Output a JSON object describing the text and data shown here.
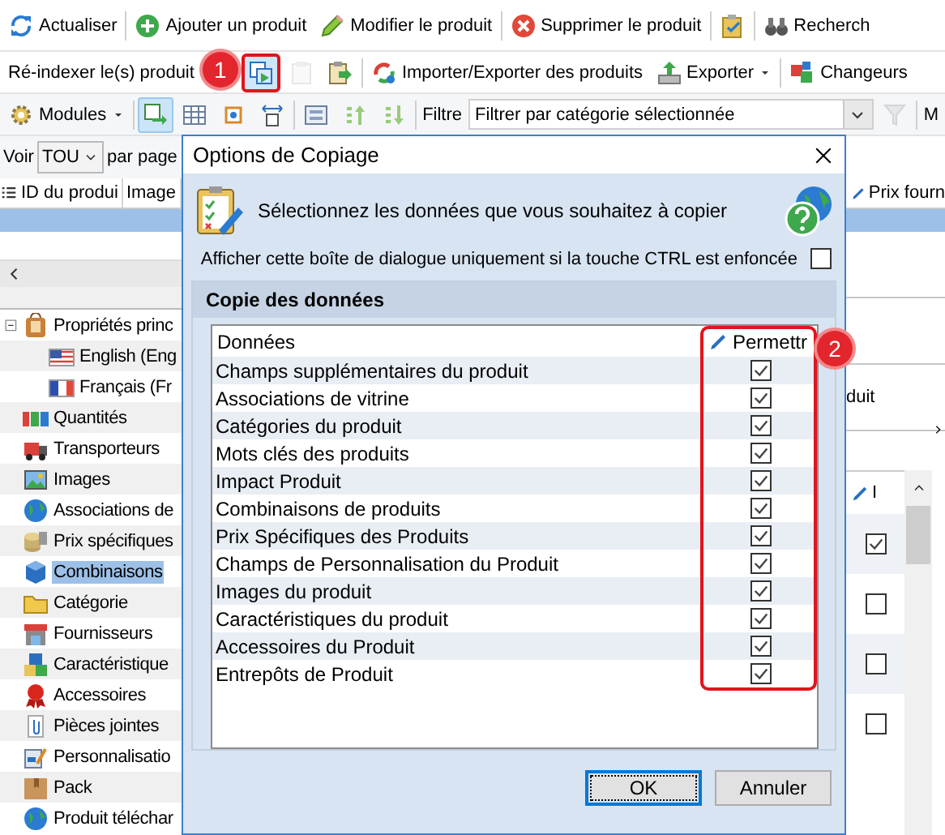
{
  "toolbar_1": [
    {
      "kind": "button",
      "label": "Actualiser"
    },
    {
      "kind": "separator"
    },
    {
      "kind": "button",
      "label": "Ajouter un produit"
    },
    {
      "kind": "button",
      "label": "Modifier le produit"
    },
    {
      "kind": "separator"
    },
    {
      "kind": "button",
      "label": "Supprimer le produit"
    },
    {
      "kind": "separator"
    },
    {
      "kind": "icon"
    },
    {
      "kind": "separator"
    },
    {
      "kind": "button",
      "label": "Recherch"
    }
  ],
  "toolbar_2": [
    {
      "kind": "label",
      "label": "Ré-indexer le(s) produit"
    },
    {
      "kind": "icon",
      "highlighted": true,
      "disabled": false,
      "badge": "1"
    },
    {
      "kind": "icon",
      "highlighted": false,
      "disabled": true
    },
    {
      "kind": "icon",
      "highlighted": false,
      "disabled": false
    },
    {
      "kind": "separator"
    },
    {
      "kind": "button",
      "label": "Importer/Exporter des produits"
    },
    {
      "kind": "menu",
      "label": "Exporter"
    },
    {
      "kind": "separator"
    },
    {
      "kind": "button",
      "label": "Changeurs"
    }
  ],
  "toolbar_3": [
    {
      "kind": "menu",
      "label": "Modules"
    },
    {
      "kind": "separator"
    },
    {
      "kind": "icon",
      "pressed": true,
      "disabled": false
    },
    {
      "kind": "icon",
      "pressed": false,
      "disabled": false
    },
    {
      "kind": "icon",
      "pressed": false,
      "disabled": false
    },
    {
      "kind": "icon",
      "pressed": false,
      "disabled": false
    },
    {
      "kind": "separator"
    },
    {
      "kind": "icon",
      "pressed": false,
      "disabled": false
    },
    {
      "kind": "icon",
      "pressed": false,
      "disabled": false
    },
    {
      "kind": "icon",
      "pressed": false,
      "disabled": false
    },
    {
      "kind": "separator"
    },
    {
      "kind": "text",
      "label": "Filtre"
    },
    {
      "kind": "dropdown",
      "label": "Filtrer par catégorie sélectionnée"
    },
    {
      "kind": "icon",
      "pressed": false,
      "disabled": true
    },
    {
      "kind": "separator"
    },
    {
      "kind": "text",
      "label": "M"
    }
  ],
  "pager": {
    "label": "Voir",
    "value": "TOU",
    "suffix": "par page"
  },
  "grid": {
    "columns": [
      {
        "label": "ID du produi"
      },
      {
        "label": "Image"
      },
      {
        "label": "Prix fourn"
      }
    ],
    "rows": [
      {
        "selected": true
      }
    ]
  },
  "tree": [
    {
      "label": "Propriétés princ",
      "expanded": true,
      "selected": false,
      "children": [
        {
          "label": "English (Eng",
          "selected": false
        },
        {
          "label": "Français (Fr",
          "selected": false
        }
      ]
    },
    {
      "label": "Quantités",
      "selected": false
    },
    {
      "label": "Transporteurs",
      "selected": false
    },
    {
      "label": "Images",
      "selected": false
    },
    {
      "label": "Associations de",
      "selected": false
    },
    {
      "label": "Prix spécifiques",
      "selected": false
    },
    {
      "label": "Combinaisons",
      "selected": true
    },
    {
      "label": "Catégorie",
      "selected": false
    },
    {
      "label": "Fournisseurs",
      "selected": false
    },
    {
      "label": "Caractéristique",
      "selected": false
    },
    {
      "label": "Accessoires",
      "selected": false
    },
    {
      "label": "Pièces jointes",
      "selected": false
    },
    {
      "label": "Personnalisatio",
      "selected": false
    },
    {
      "label": "Pack",
      "selected": false
    },
    {
      "label": "Produit téléchar",
      "selected": false
    }
  ],
  "detail_panel": {
    "text": "duit"
  },
  "sub_grid": {
    "column": "I",
    "rows": [
      {
        "checked": true
      },
      {
        "checked": false
      },
      {
        "checked": false
      },
      {
        "checked": false
      }
    ]
  },
  "dialog": {
    "title": "Options de Copiage",
    "message": "Sélectionnez les données que vous souhaitez à copier",
    "ctrl_option": {
      "label": "Afficher cette boîte de dialogue uniquement si la touche CTRL est enfoncée",
      "checked": false
    },
    "section_title": "Copie des données",
    "columns": [
      {
        "label": "Données"
      },
      {
        "label": "Permettr",
        "highlighted": true,
        "badge": "2"
      }
    ],
    "rows": [
      {
        "label": "Champs supplémentaires du produit",
        "checked": true
      },
      {
        "label": "Associations de vitrine",
        "checked": true
      },
      {
        "label": "Catégories du produit",
        "checked": true
      },
      {
        "label": "Mots clés des produits",
        "checked": true
      },
      {
        "label": "Impact Produit",
        "checked": true
      },
      {
        "label": "Combinaisons de produits",
        "checked": true
      },
      {
        "label": "Prix Spécifiques des Produits",
        "checked": true
      },
      {
        "label": "Champs de Personnalisation du Produit",
        "checked": true
      },
      {
        "label": "Images du produit",
        "checked": true
      },
      {
        "label": "Caractéristiques du produit",
        "checked": true
      },
      {
        "label": "Accessoires du Produit",
        "checked": true
      },
      {
        "label": "Entrepôts de Produit",
        "checked": true
      }
    ],
    "buttons": [
      {
        "label": "OK",
        "default": true
      },
      {
        "label": "Annuler",
        "default": false
      }
    ]
  }
}
